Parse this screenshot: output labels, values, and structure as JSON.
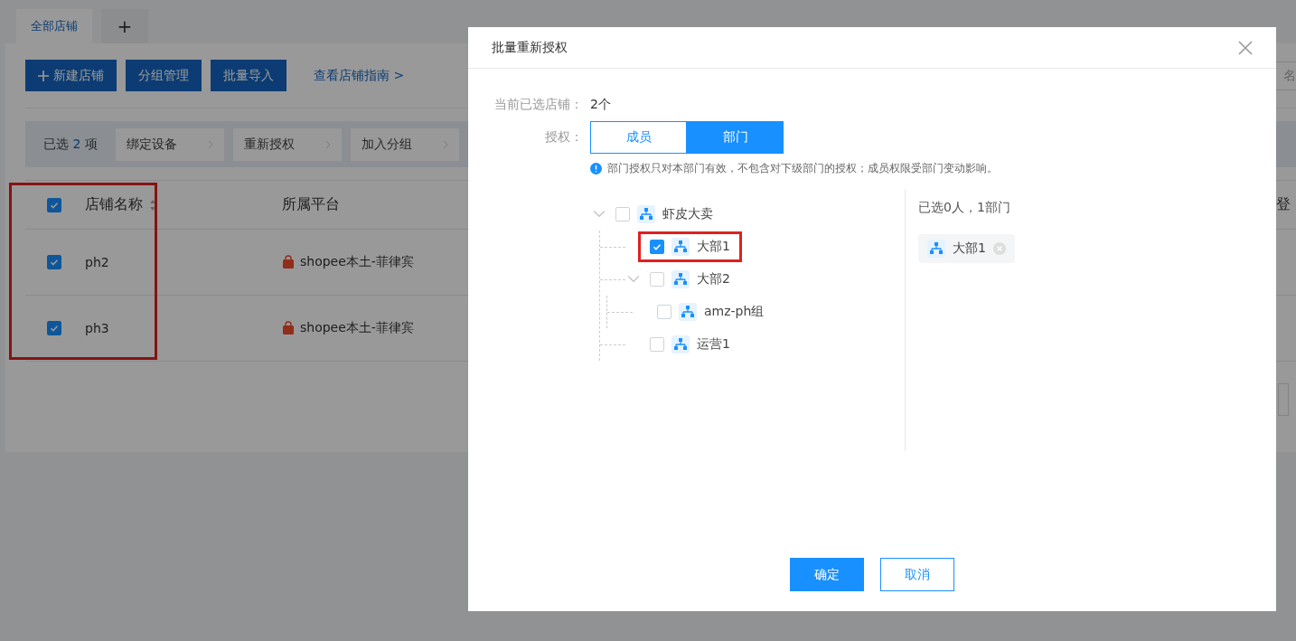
{
  "tabs": [
    {
      "label": "全部店铺",
      "selected": true
    },
    {
      "label": "+",
      "selected": false
    }
  ],
  "toolbar": {
    "buttons": [
      {
        "label": "新建店铺",
        "kind": "add"
      },
      {
        "label": "分组管理",
        "kind": "plain"
      },
      {
        "label": "批量导入",
        "kind": "plain"
      }
    ],
    "guide_link": "查看店铺指南 >",
    "search": {
      "placeholder": "名"
    }
  },
  "selection_bar": {
    "prefix": "已选",
    "count": "2",
    "suffix": "项",
    "actions": [
      "绑定设备",
      "重新授权",
      "加入分组"
    ]
  },
  "table": {
    "select_all": true,
    "columns": [
      "店铺名称",
      "所属平台",
      "登"
    ],
    "rows": [
      {
        "checked": true,
        "name": "ph2",
        "platform": "shopee本土-菲律宾"
      },
      {
        "checked": true,
        "name": "ph3",
        "platform": "shopee本土-菲律宾"
      }
    ]
  },
  "dialog": {
    "title": "批量重新授权",
    "current_label": "当前已选店铺：",
    "current_value": "2个",
    "auth_label": "授权：",
    "auth_tabs": [
      {
        "label": "成员",
        "selected": false
      },
      {
        "label": "部门",
        "selected": true
      }
    ],
    "note": "部门授权只对本部门有效，不包含对下级部门的授权；成员权限受部门变动影响。",
    "tree": [
      {
        "label": "虾皮大卖",
        "checked": false,
        "expanded": true,
        "children": [
          {
            "label": "大部1",
            "checked": true,
            "highlighted": true
          },
          {
            "label": "大部2",
            "checked": false,
            "expanded": true,
            "children": [
              {
                "label": "amz-ph组",
                "checked": false
              }
            ]
          },
          {
            "label": "运营1",
            "checked": false
          }
        ]
      }
    ],
    "summary": "已选0人，1部门",
    "selected_tags": [
      "大部1"
    ],
    "buttons": [
      {
        "label": "确定",
        "kind": "primary"
      },
      {
        "label": "取消",
        "kind": "secondary"
      }
    ]
  }
}
